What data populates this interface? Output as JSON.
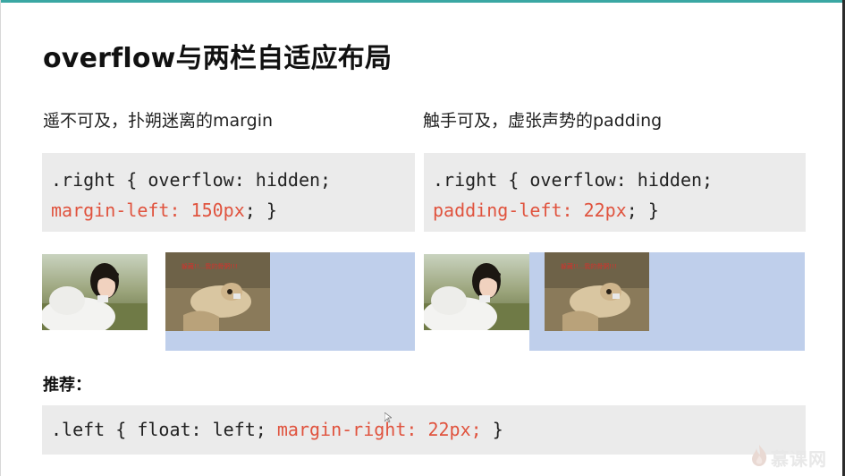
{
  "slide": {
    "title": "overflow与两栏自适应布局",
    "left_heading": "遥不可及，扑朔迷离的margin",
    "right_heading": "触手可及，虚张声势的padding",
    "code_left": {
      "line1": ".right { overflow: hidden;",
      "line2_red": "margin-left: 150px",
      "line2_rest": "; }"
    },
    "code_right": {
      "line1": ".right { overflow: hidden;",
      "line2_red": "padding-left: 22px",
      "line2_rest": "; }"
    },
    "photo_caption": "躲藏!!...我的骨粥!!!",
    "recommend_label": "推荐：",
    "code_bottom": {
      "part1": ".left { float: left; ",
      "part_red": "margin-right: 22px;",
      "part2": " }"
    }
  },
  "watermark": {
    "text": "慕课网",
    "icon": "flame-logo-icon"
  },
  "colors": {
    "accent_bar": "#3aa7a3",
    "code_bg": "#ebebeb",
    "code_red": "#e0533e",
    "blue_box": "#bfcfeb"
  }
}
